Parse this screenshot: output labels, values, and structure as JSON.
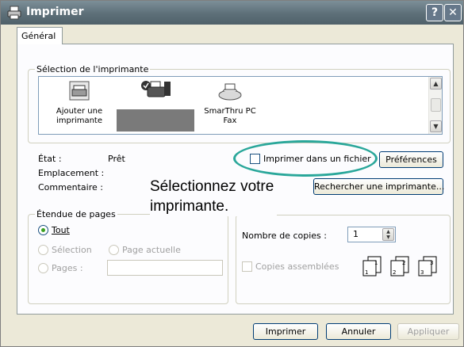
{
  "window": {
    "title": "Imprimer",
    "help_label": "?",
    "close_label": "✕"
  },
  "tabs": [
    {
      "label": "Général"
    }
  ],
  "printer_selection": {
    "legend": "Sélection de l'imprimante",
    "printers": [
      {
        "label_line1": "Ajouter une",
        "label_line2": "imprimante"
      },
      {
        "label_line1": "SmarThru PC",
        "label_line2": "Fax"
      }
    ]
  },
  "status": {
    "state_label": "État :",
    "state_value": "Prêt",
    "location_label": "Emplacement :",
    "comment_label": "Commentaire :",
    "print_to_file_label": "Imprimer dans un fichier",
    "preferences_label": "Préférences",
    "find_printer_label": "Rechercher une imprimante..."
  },
  "annotation": {
    "line1": "Sélectionnez votre",
    "line2": "imprimante."
  },
  "page_range": {
    "legend": "Étendue de pages",
    "all_label": "Tout",
    "selection_label": "Sélection",
    "current_page_label": "Page actuelle",
    "pages_label": "Pages :",
    "pages_value": ""
  },
  "copies": {
    "count_label": "Nombre de copies :",
    "count_value": "1",
    "collate_label": "Copies assemblées"
  },
  "footer": {
    "print_label": "Imprimer",
    "cancel_label": "Annuler",
    "apply_label": "Appliquer"
  },
  "colors": {
    "callout": "#2aa79a",
    "radio_selected": "#3aa020"
  }
}
